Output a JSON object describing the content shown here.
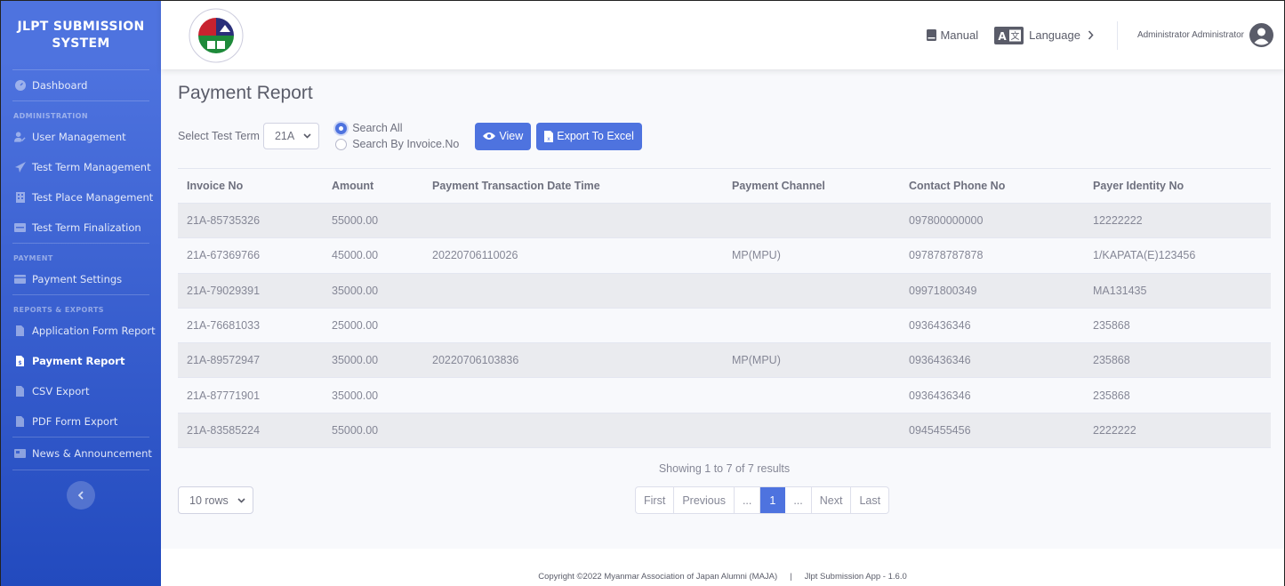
{
  "sidebar": {
    "brand_line1": "JLPT SUBMISSION",
    "brand_line2": "SYSTEM",
    "dashboard": {
      "label": "Dashboard",
      "icon": "tachometer-icon"
    },
    "sections": [
      {
        "heading": "ADMINISTRATION",
        "items": [
          {
            "label": "User Management",
            "icon": "user-edit-icon"
          },
          {
            "label": "Test Term Management",
            "icon": "paper-plane-icon"
          },
          {
            "label": "Test Place Management",
            "icon": "building-icon"
          },
          {
            "label": "Test Term Finalization",
            "icon": "id-card-icon"
          }
        ]
      },
      {
        "heading": "PAYMENT",
        "items": [
          {
            "label": "Payment Settings",
            "icon": "credit-card-icon"
          }
        ]
      },
      {
        "heading": "REPORTS & EXPORTS",
        "items": [
          {
            "label": "Application Form Report",
            "icon": "file-icon"
          },
          {
            "label": "Payment Report",
            "icon": "file-invoice-dollar-icon",
            "active": true
          },
          {
            "label": "CSV Export",
            "icon": "file-csv-icon"
          },
          {
            "label": "PDF Form Export",
            "icon": "file-pdf-icon"
          }
        ]
      }
    ],
    "news": {
      "label": "News & Announcement",
      "icon": "newspaper-icon"
    },
    "toggle_icon": "chevron-left-icon"
  },
  "topbar": {
    "logo": "maja-logo",
    "manual_label": "Manual",
    "language_label": "Language",
    "user_name": "Administrator Administrator"
  },
  "page": {
    "title": "Payment Report",
    "filter_label": "Select Test Term",
    "test_term_value": "21A",
    "radio_search_all": "Search All",
    "radio_search_invoice": "Search By Invoice.No",
    "selected_radio": "search_all",
    "view_label": "View",
    "export_label": "Export To Excel"
  },
  "table": {
    "columns": [
      "Invoice No",
      "Amount",
      "Payment Transaction Date Time",
      "Payment Channel",
      "Contact Phone No",
      "Payer Identity No"
    ],
    "rows": [
      [
        "21A-85735326",
        "55000.00",
        "",
        "",
        "097800000000",
        "12222222"
      ],
      [
        "21A-67369766",
        "45000.00",
        "20220706110026",
        "MP(MPU)",
        "097878787878",
        "1/KAPATA(E)123456"
      ],
      [
        "21A-79029391",
        "35000.00",
        "",
        "",
        "09971800349",
        "MA131435"
      ],
      [
        "21A-76681033",
        "25000.00",
        "",
        "",
        "0936436346",
        "235868"
      ],
      [
        "21A-89572947",
        "35000.00",
        "20220706103836",
        "MP(MPU)",
        "0936436346",
        "235868"
      ],
      [
        "21A-87771901",
        "35000.00",
        "",
        "",
        "0936436346",
        "235868"
      ],
      [
        "21A-83585224",
        "55000.00",
        "",
        "",
        "0945455456",
        "2222222"
      ]
    ]
  },
  "pagination": {
    "results_text": "Showing 1 to 7 of 7 results",
    "rows_per_page": "10 rows",
    "first": "First",
    "previous": "Previous",
    "ellipsis_left": "...",
    "current_page": "1",
    "ellipsis_right": "...",
    "next": "Next",
    "last": "Last"
  },
  "footer": {
    "copyright": "Copyright ©2022 Myanmar Association of Japan Alumni (MAJA)",
    "separator": "|",
    "app_version": "Jlpt Submission App - 1.6.0"
  },
  "colors": {
    "primary": "#4e73df",
    "sidebar_gradient_start": "#4e73df",
    "sidebar_gradient_end": "#224abe"
  }
}
